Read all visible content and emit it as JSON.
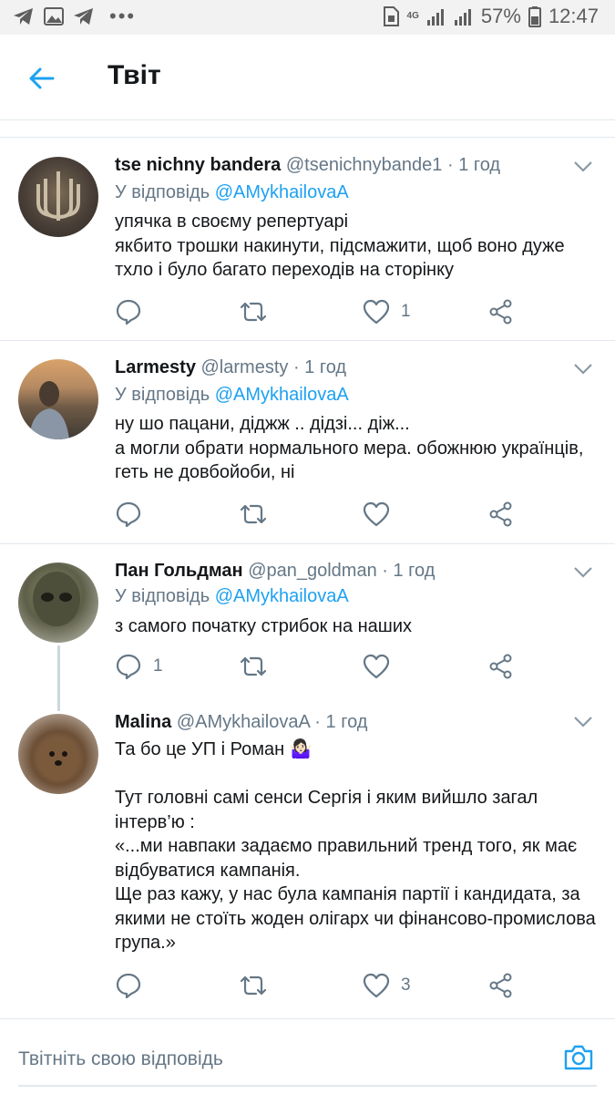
{
  "status_bar": {
    "battery": "57%",
    "time": "12:47",
    "network": "4G"
  },
  "header": {
    "title": "Твіт"
  },
  "tweets": [
    {
      "name": "tse nichny bandera",
      "handle": "@tsenichnybande1",
      "time": "1 год",
      "reply_prefix": "У відповідь",
      "reply_mention": "@AMykhailovaA",
      "text": "упячка в своєму репертуарі\nякбито трошки накинути, підсмажити, щоб воно дуже тхло і було багато переходів на сторінку",
      "reply_count": "",
      "like_count": "1"
    },
    {
      "name": "Larmesty",
      "handle": "@larmesty",
      "time": "1 год",
      "reply_prefix": "У відповідь",
      "reply_mention": "@AMykhailovaA",
      "text": "ну шо пацани, діджж .. дідзі... діж...\nа могли обрати нормального мера. обожнюю українців, геть не довбойоби, ні",
      "reply_count": "",
      "like_count": ""
    },
    {
      "name": "Пан Гольдман",
      "handle": "@pan_goldman",
      "time": "1 год",
      "reply_prefix": "У відповідь",
      "reply_mention": "@AMykhailovaA",
      "text": "з самого початку стрибок на наших",
      "reply_count": "1",
      "like_count": ""
    },
    {
      "name": "Malina",
      "handle": "@AMykhailovaA",
      "time": "1 год",
      "text": "Та бо це УП і Роман 🤷🏻‍♀️\n\nТут головні самі сенси Сергія і яким вийшло загал інтерв’ю :\n«...ми навпаки задаємо правильний тренд того, як має відбуватися кампанія.\nЩе раз кажу, у нас була кампанія партії і кандидата, за якими не стоїть жоден олігарх чи фінансово-промислова група.»",
      "reply_count": "",
      "like_count": "3"
    }
  ],
  "compose": {
    "placeholder": "Твітніть свою відповідь"
  },
  "colors": {
    "accent": "#1da1f2",
    "secondary_text": "#657786",
    "divider": "#e1e8ed"
  },
  "icons": [
    "back-arrow-icon",
    "chevron-down-icon",
    "reply-icon",
    "retweet-icon",
    "like-icon",
    "share-icon",
    "camera-icon"
  ]
}
